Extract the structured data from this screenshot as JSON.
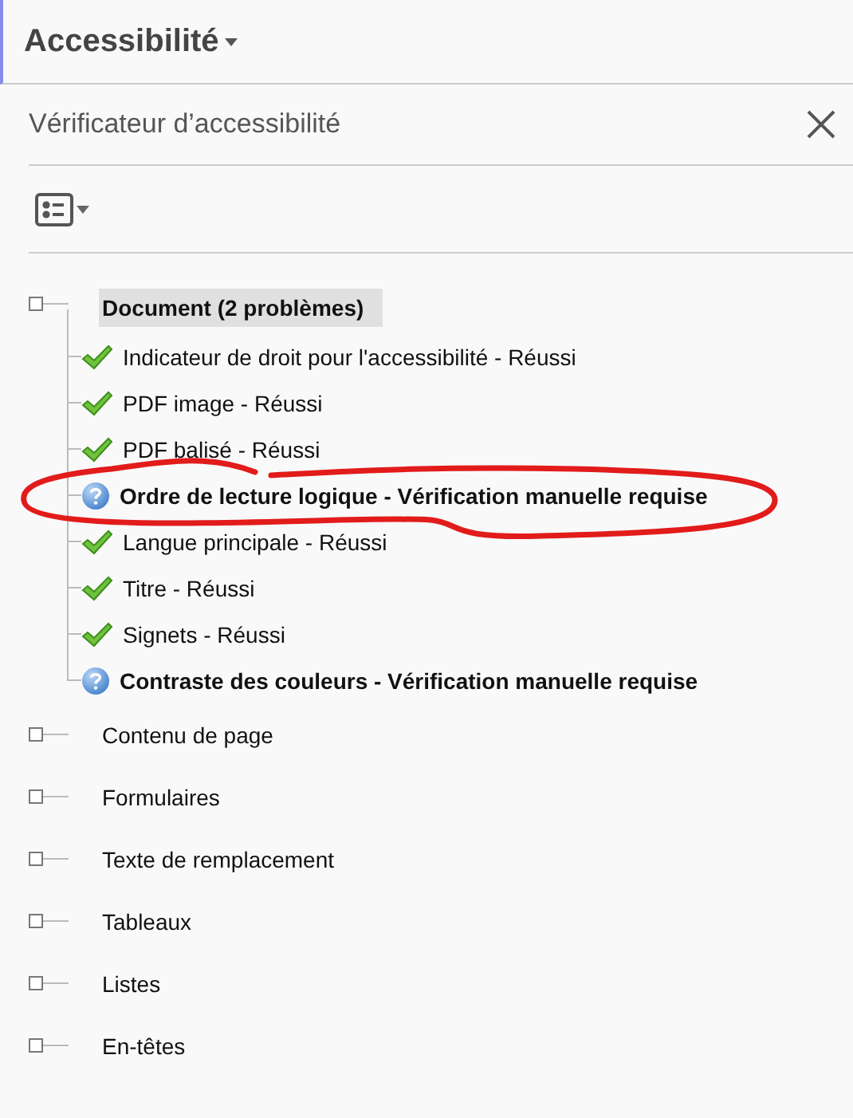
{
  "header": {
    "title": "Accessibilité"
  },
  "panel": {
    "title": "Vérificateur d’accessibilité"
  },
  "tree": [
    {
      "label": "Document (2 problèmes)",
      "selected": true,
      "children": [
        {
          "kind": "passed",
          "label": "Indicateur de droit pour l'accessibilité - Réussi",
          "circled": false
        },
        {
          "kind": "passed",
          "label": "PDF image - Réussi",
          "circled": false
        },
        {
          "kind": "passed",
          "label": "PDF balisé - Réussi",
          "circled": false
        },
        {
          "kind": "manual",
          "label": "Ordre de lecture logique - Vérification manuelle requise",
          "circled": true
        },
        {
          "kind": "passed",
          "label": "Langue principale - Réussi",
          "circled": false
        },
        {
          "kind": "passed",
          "label": "Titre - Réussi",
          "circled": false
        },
        {
          "kind": "passed",
          "label": "Signets - Réussi",
          "circled": false
        },
        {
          "kind": "manual",
          "label": "Contraste des couleurs - Vérification manuelle requise",
          "circled": false
        }
      ]
    },
    {
      "label": "Contenu de page",
      "selected": false
    },
    {
      "label": "Formulaires",
      "selected": false
    },
    {
      "label": "Texte de remplacement",
      "selected": false
    },
    {
      "label": "Tableaux",
      "selected": false
    },
    {
      "label": "Listes",
      "selected": false
    },
    {
      "label": "En-têtes",
      "selected": false
    }
  ]
}
